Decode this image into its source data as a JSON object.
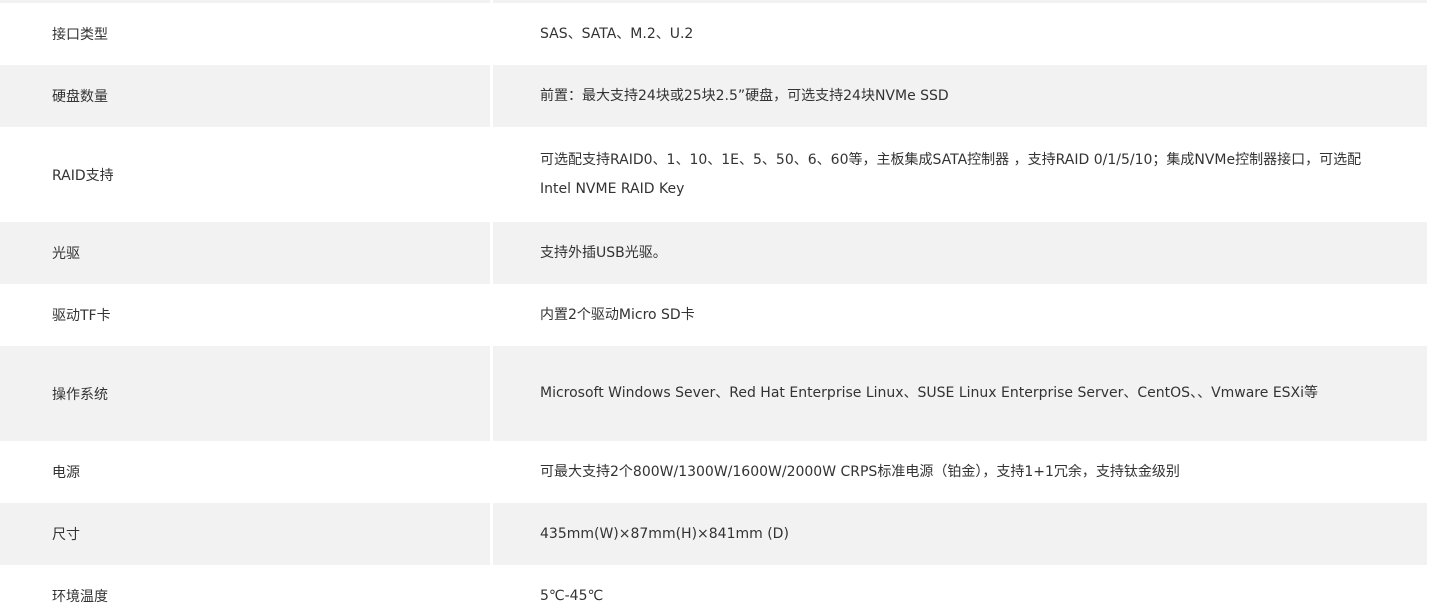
{
  "rows": [
    {
      "label": "接口类型",
      "value": "SAS、SATA、M.2、U.2"
    },
    {
      "label": "硬盘数量",
      "value": "前置：最大支持24块或25块2.5”硬盘，可选支持24块NVMe SSD"
    },
    {
      "label": "RAID支持",
      "value": "可选配支持RAID0、1、10、1E、5、50、6、60等，主板集成SATA控制器 ，支持RAID 0/1/5/10；集成NVMe控制器接口，可选配Intel NVME RAID Key"
    },
    {
      "label": "光驱",
      "value": "支持外插USB光驱。"
    },
    {
      "label": "驱动TF卡",
      "value": "内置2个驱动Micro SD卡"
    },
    {
      "label": "操作系统",
      "value": "Microsoft Windows Sever、Red Hat Enterprise Linux、SUSE Linux Enterprise Server、CentOS、、Vmware ESXi等"
    },
    {
      "label": "电源",
      "value": "可最大支持2个800W/1300W/1600W/2000W CRPS标准电源（铂金），支持1+1冗余，支持钛金级别"
    },
    {
      "label": "尺寸",
      "value": "435mm(W)×87mm(H)×841mm (D)"
    },
    {
      "label": "环境温度",
      "value": "5℃-45℃"
    }
  ]
}
